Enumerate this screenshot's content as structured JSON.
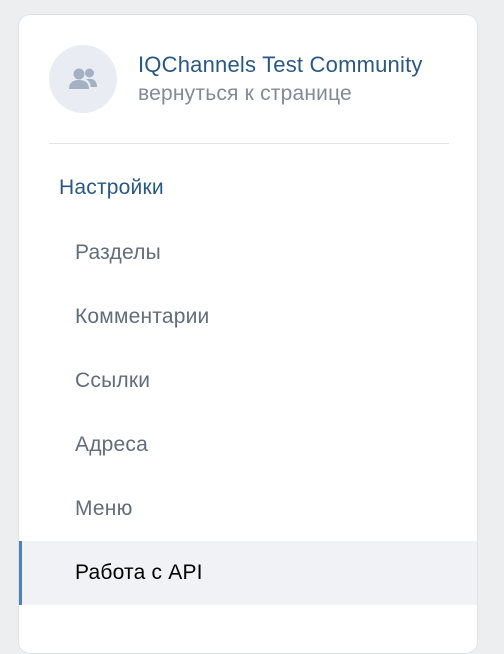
{
  "community": {
    "name": "IQChannels Test Community",
    "back_link": "вернуться к странице",
    "avatar_icon": "community-group-icon"
  },
  "settings": {
    "title": "Настройки",
    "items": [
      {
        "label": "Разделы",
        "active": false
      },
      {
        "label": "Комментарии",
        "active": false
      },
      {
        "label": "Ссылки",
        "active": false
      },
      {
        "label": "Адреса",
        "active": false
      },
      {
        "label": "Меню",
        "active": false
      },
      {
        "label": "Работа с API",
        "active": true
      }
    ]
  },
  "colors": {
    "link": "#2a5885",
    "muted": "#828a96",
    "menu_text": "#626d7a",
    "active_bg": "#f0f2f5",
    "active_bar": "#5181b8"
  }
}
